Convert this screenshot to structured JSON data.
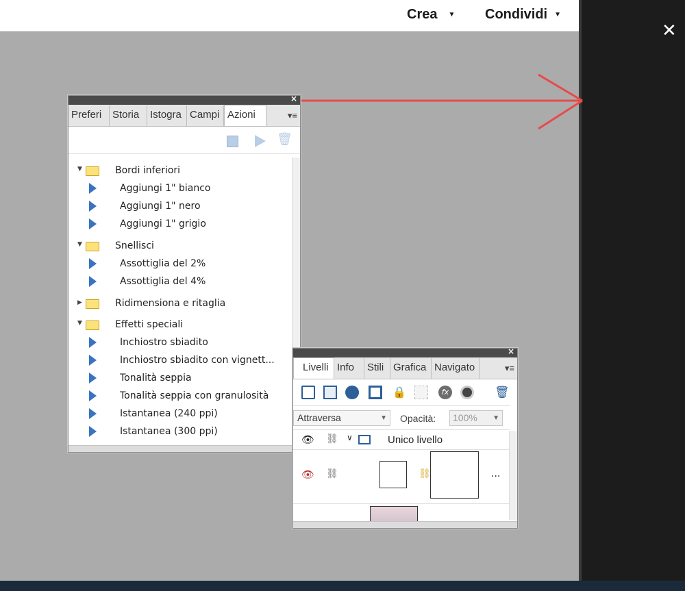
{
  "header": {
    "crea_label": "Crea",
    "condividi_label": "Condividi"
  },
  "overlay": {
    "close_glyph": "✕"
  },
  "actions_panel": {
    "tabs": [
      "Preferi",
      "Storia",
      "Istogra",
      "Campi",
      "Azioni"
    ],
    "active_tab": "Azioni",
    "groups": [
      {
        "name": "Bordi inferiori",
        "expanded": true,
        "items": [
          "Aggiungi 1\" bianco",
          "Aggiungi 1\" nero",
          "Aggiungi 1\" grigio"
        ]
      },
      {
        "name": "Snellisci",
        "expanded": true,
        "items": [
          "Assottiglia del 2%",
          "Assottiglia del 4%"
        ]
      },
      {
        "name": "Ridimensiona e ritaglia",
        "expanded": false,
        "items": []
      },
      {
        "name": "Effetti speciali",
        "expanded": true,
        "items": [
          "Inchiostro sbiadito",
          "Inchiostro sbiadito con vignett...",
          "Tonalità seppia",
          "Tonalità seppia con granulosità",
          "Istantanea (240 ppi)",
          "Istantanea (300 ppi)"
        ]
      }
    ]
  },
  "layers_panel": {
    "tabs": [
      "Livelli",
      "Info",
      "Stili",
      "Grafica",
      "Navigato"
    ],
    "active_tab": "Livelli",
    "blend_mode": "Attraversa",
    "opacity_label": "Opacità:",
    "opacity_value": "100%",
    "group_name": "Unico livello",
    "more_glyph": "..."
  },
  "colors": {
    "canvas_bg": "#ababab",
    "accent_arrow": "#e84a4a",
    "play_icon": "#3a73c0",
    "folder": "#fbe27b"
  }
}
